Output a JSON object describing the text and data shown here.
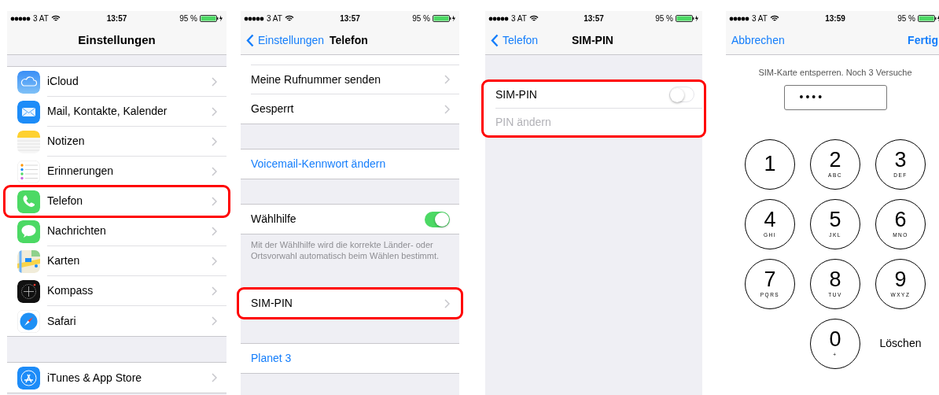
{
  "settings": {
    "status_bar": {
      "carrier": "3 AT",
      "time": "13:57",
      "battery": "95 %"
    },
    "nav": {
      "title": "Einstellungen"
    },
    "sections": [
      {
        "rows": [
          {
            "label": "iCloud",
            "kind": "cloud",
            "highlighted": false
          },
          {
            "label": "Mail, Kontakte, Kalender",
            "kind": "mail",
            "highlighted": false
          },
          {
            "label": "Notizen",
            "kind": "notes",
            "highlighted": false
          },
          {
            "label": "Erinnerungen",
            "kind": "reminders",
            "highlighted": false
          },
          {
            "label": "Telefon",
            "kind": "phone",
            "highlighted": true
          },
          {
            "label": "Nachrichten",
            "kind": "messages",
            "highlighted": false
          },
          {
            "label": "Karten",
            "kind": "maps",
            "highlighted": false
          },
          {
            "label": "Kompass",
            "kind": "compass",
            "highlighted": false
          },
          {
            "label": "Safari",
            "kind": "safari",
            "highlighted": false
          }
        ]
      },
      {
        "rows": [
          {
            "label": "iTunes & App Store",
            "kind": "appstore",
            "highlighted": false
          }
        ]
      }
    ]
  },
  "phone": {
    "status_bar": {
      "carrier": "3 AT",
      "time": "13:57",
      "battery": "95 %"
    },
    "nav": {
      "back": "Einstellungen",
      "title": "Telefon"
    },
    "sections": [
      {
        "rows": [
          {
            "label": "Meine Rufnummer senden",
            "kind": "disclosure",
            "highlighted": false
          },
          {
            "label": "Gesperrt",
            "kind": "disclosure",
            "highlighted": false
          }
        ]
      },
      {
        "rows": [
          {
            "label": "Voicemail-Kennwort ändern",
            "kind": "link",
            "highlighted": false
          }
        ]
      },
      {
        "rows": [
          {
            "label": "Wählhilfe",
            "kind": "toggle",
            "on": true,
            "highlighted": false
          }
        ],
        "footer": "Mit der Wählhilfe wird die korrekte Länder- oder Ortsvorwahl automatisch beim Wählen bestimmt."
      },
      {
        "rows": [
          {
            "label": "SIM-PIN",
            "kind": "disclosure",
            "highlighted": true
          }
        ]
      },
      {
        "rows": [
          {
            "label": "Planet 3",
            "kind": "link",
            "highlighted": false
          }
        ]
      }
    ]
  },
  "sim_pin": {
    "status_bar": {
      "carrier": "3 AT",
      "time": "13:57",
      "battery": "95 %"
    },
    "nav": {
      "back": "Telefon",
      "title": "SIM-PIN"
    },
    "section": {
      "highlighted": true,
      "rows": [
        {
          "label": "SIM-PIN",
          "kind": "toggle",
          "on": false,
          "disabled": false
        },
        {
          "label": "PIN ändern",
          "kind": "plain",
          "disabled": true
        }
      ]
    }
  },
  "unlock": {
    "status_bar": {
      "carrier": "3 AT",
      "time": "13:59",
      "battery": "95 %"
    },
    "nav": {
      "cancel": "Abbrechen",
      "done": "Fertig"
    },
    "prompt": "SIM-Karte entsperren. Noch 3 Versuche",
    "pin_field": {
      "value": "••••"
    },
    "keys": [
      {
        "digit": "1"
      },
      {
        "digit": "2",
        "letters": "ABC"
      },
      {
        "digit": "3",
        "letters": "DEF"
      },
      {
        "digit": "4",
        "letters": "GHI"
      },
      {
        "digit": "5",
        "letters": "JKL"
      },
      {
        "digit": "6",
        "letters": "MNO"
      },
      {
        "digit": "7",
        "letters": "PQRS"
      },
      {
        "digit": "8",
        "letters": "TUV"
      },
      {
        "digit": "9",
        "letters": "WXYZ"
      },
      {
        "digit": "0",
        "letters": "+"
      }
    ],
    "delete": "Löschen"
  }
}
